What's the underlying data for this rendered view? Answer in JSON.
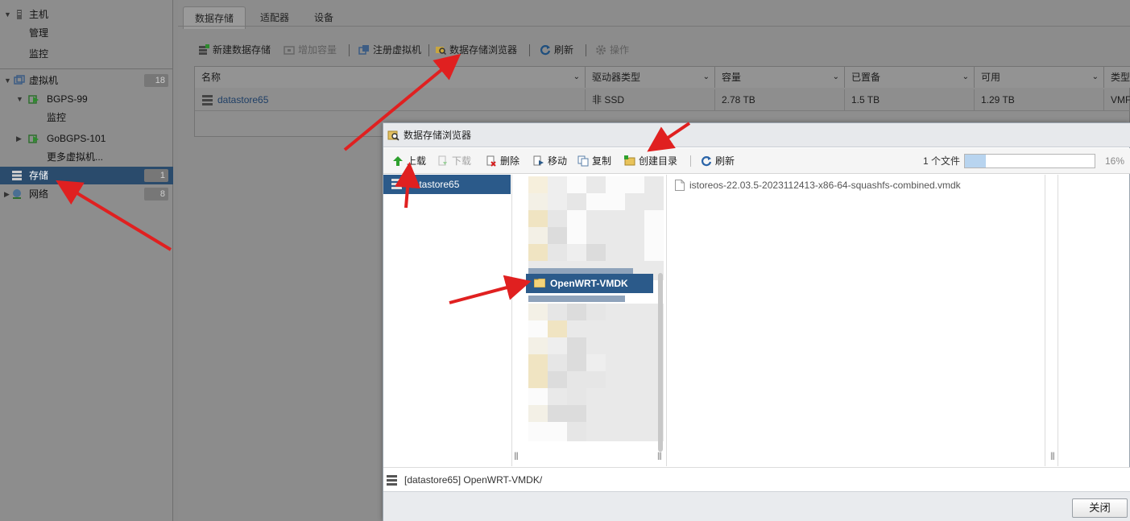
{
  "nav": {
    "host": "主机",
    "manage": "管理",
    "monitor": "监控",
    "vms": "虚拟机",
    "vms_count": "18",
    "vm1": "BGPS-99",
    "vm1_monitor": "监控",
    "vm2": "GoBGPS-101",
    "more_vms": "更多虚拟机...",
    "storage": "存储",
    "storage_count": "1",
    "network": "网络",
    "network_count": "8"
  },
  "main": {
    "tabs": [
      "数据存储",
      "适配器",
      "设备"
    ],
    "toolbar": {
      "new_datastore": "新建数据存储",
      "increase_capacity": "增加容量",
      "register_vm": "注册虚拟机",
      "datastore_browser": "数据存储浏览器",
      "refresh": "刷新",
      "actions": "操作"
    },
    "grid": {
      "headers": [
        "名称",
        "驱动器类型",
        "容量",
        "已置备",
        "可用",
        "类型"
      ],
      "row": [
        "datastore65",
        "非 SSD",
        "2.78 TB",
        "1.5 TB",
        "1.29 TB",
        "VMF"
      ]
    }
  },
  "dialog": {
    "title": "数据存储浏览器",
    "toolbar": {
      "upload": "上载",
      "download": "下载",
      "delete": "删除",
      "move": "移动",
      "copy": "复制",
      "create_dir": "创建目录",
      "refresh": "刷新"
    },
    "file_count": "1 个文件",
    "progress_pct": "16%",
    "progress_value": 0.16,
    "datastore": "datastore65",
    "selected_folder": "OpenWRT-VMDK",
    "file": "istoreos-22.03.5-2023112413-x86-64-squashfs-combined.vmdk",
    "path": "[datastore65] OpenWRT-VMDK/",
    "close": "关闭"
  },
  "colors": {
    "selection": "#2b5a8a",
    "annotation_arrow": "#e02020"
  }
}
